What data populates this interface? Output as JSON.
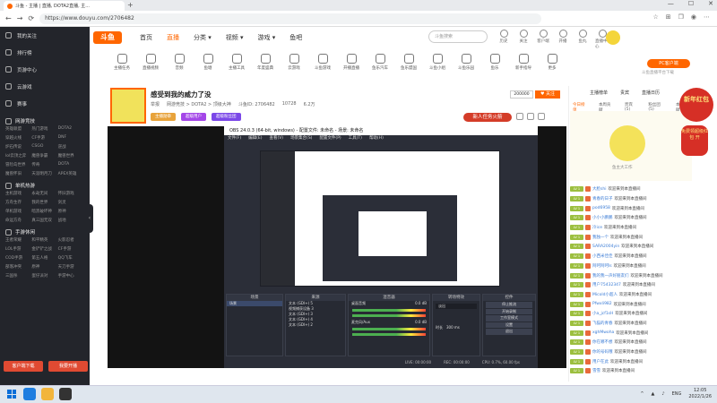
{
  "browser": {
    "tab_title": "斗鱼 - 主播 | 直播, DOTA2直播, 主...",
    "new_tab": "+",
    "url": "https://www.douyu.com/2706482",
    "win_controls": [
      "—",
      "☐",
      "✕"
    ],
    "nav": [
      "←",
      "→",
      "⟳"
    ]
  },
  "header": {
    "logo": "斗鱼",
    "nav": [
      "首页",
      "直播",
      "分类 ▾",
      "视频 ▾",
      "游戏 ▾",
      "鱼吧"
    ],
    "search_placeholder": "斗鱼搜索",
    "tools": [
      "历史",
      "关注",
      "客户端",
      "开播",
      "鱼丸",
      "直播中心"
    ]
  },
  "sidebar": {
    "items": [
      "我的关注",
      "排行榜",
      "页游中心",
      "云游戏",
      "赛事"
    ],
    "sections": [
      {
        "title": "网游竞技",
        "items": [
          "英雄联盟",
          "热门游戏",
          "DOTA2",
          "穿越火线",
          "CF手游",
          "DNF",
          "炉石传说",
          "CSGO",
          "逆战",
          "lol云顶之弈",
          "魔兽争霸",
          "魔兽世界",
          "冒险岛世界",
          "传奇",
          "DOTA",
          "魔兽怀旧",
          "天涯明月刀",
          "APEX英雄"
        ]
      },
      {
        "title": "单机热游",
        "items": [
          "主机游戏",
          "永劫无间",
          "怀旧游戏",
          "方舟生存",
          "我的世界",
          "剑灵",
          "单机游戏",
          "暗黑破坏神",
          "原神",
          "命运方舟",
          "真三国无双",
          "战地"
        ]
      },
      {
        "title": "手游休闲",
        "items": [
          "王者荣耀",
          "和平精英",
          "火影忍者",
          "LOL手游",
          "金铲铲之战",
          "CF手游",
          "COD手游",
          "第五人格",
          "QQ飞车",
          "部落冲突",
          "原神",
          "天刀手游",
          "三国杀",
          "蛋仔派对",
          "手游中心"
        ]
      }
    ],
    "bottom_buttons": [
      "客户端下载",
      "我要开播"
    ],
    "collapse": "‹"
  },
  "categories": [
    "主播任务",
    "直播视频",
    "音频",
    "鱼塘",
    "主播工具",
    "年度盛典",
    "云游戏",
    "斗鱼游戏",
    "开播直播",
    "鱼乐汽车",
    "鱼乐盟国",
    "斗鱼小组",
    "斗鱼乐园",
    "鱼乐",
    "新手指导",
    "更多"
  ],
  "pc_download": {
    "label": "PC客户端",
    "sub": "斗鱼直播平台下载"
  },
  "stream": {
    "title": "感受到我的威力了没",
    "meta": [
      "举报",
      "网游竞技 > DOTA2 > 顶级大神",
      "斗鱼ID: 2706482",
      "10728",
      "6.2万"
    ],
    "tags": [
      "主播勋章",
      "超级用户",
      "超级粉丝团"
    ],
    "fans": "200000",
    "follow": "♥ 关注",
    "task": "新人任务火箭"
  },
  "obs": {
    "title": "OBS 24.0.3 (64-bit, windows) - 配置文件: 未命名 - 场景: 未命名",
    "menu": [
      "文件(F)",
      "编辑(E)",
      "查看(V)",
      "场景集合(S)",
      "配置文件(P)",
      "工具(T)",
      "帮助(H)"
    ],
    "docks": [
      "场景",
      "来源",
      "混音器",
      "转场特效",
      "控件"
    ],
    "scene": "场景",
    "sources": [
      "文本 (GDI+) 5",
      "视频捕获设备 3",
      "文本 (GDI+) 3",
      "文本 (GDI+) 4",
      "文本 (GDI+) 2"
    ],
    "mixer": [
      {
        "name": "桌面音频",
        "db": "0.0 dB"
      },
      {
        "name": "麦克风/Aux",
        "db": "0.0 dB"
      }
    ],
    "transition": "淡出",
    "duration_label": "时长",
    "duration": "300 ms",
    "controls": [
      "停止推流",
      "开始录制",
      "工作室模式",
      "设置",
      "退出"
    ],
    "status": [
      "LIVE: 00:00:00",
      "REC: 00:00:00",
      "CPU: 0.7%, 60.00 fps"
    ]
  },
  "right_panel": {
    "tabs": [
      "主播榜单",
      "贵宾",
      "直播日历"
    ],
    "subtabs": [
      "今日榜单",
      "本周贡献",
      "贵宾(5)",
      "粉丝团(5)",
      "本周贡献"
    ],
    "banner_text": "鱼主大工作",
    "new_year": "新年红包",
    "promo": "免费领超级红包 开",
    "chat": [
      {
        "lv": "LV 1",
        "user": "大脸shi",
        "msg": "欢迎来到本直播间"
      },
      {
        "lv": "LV 1",
        "user": "青春的日子",
        "msg": "欢迎来到本直播间"
      },
      {
        "lv": "LV 1",
        "user": "pod6958",
        "msg": "欢迎来到本直播间"
      },
      {
        "lv": "LV 1",
        "user": "小小小鹏鹏",
        "msg": "欢迎来到本直播间"
      },
      {
        "lv": "LV 1",
        "user": "冷ice",
        "msg": "欢迎来到本直播间"
      },
      {
        "lv": "LV 1",
        "user": "我独一个",
        "msg": "欢迎来到本直播间"
      },
      {
        "lv": "LV 1",
        "user": "SARA2004yin",
        "msg": "欢迎来到本直播间"
      },
      {
        "lv": "LV 1",
        "user": "小西米佳佳",
        "msg": "欢迎来到本直播间"
      },
      {
        "lv": "LV 1",
        "user": "阿呵阿呵ls",
        "msg": "欢迎来到本直播间"
      },
      {
        "lv": "LV 1",
        "user": "我的我一声好朋友们",
        "msg": "欢迎来到本直播间"
      },
      {
        "lv": "LV 1",
        "user": "用户75432347",
        "msg": "欢迎来到本直播间"
      },
      {
        "lv": "LV 1",
        "user": "Micold小超人",
        "msg": "欢迎来到本直播间"
      },
      {
        "lv": "LV 1",
        "user": "Pfwxli982",
        "msg": "欢迎来到本直播间"
      },
      {
        "lv": "LV 1",
        "user": "小a_jcf1sH",
        "msg": "欢迎来到本直播间"
      },
      {
        "lv": "LV 1",
        "user": "飞猫的青春",
        "msg": "欢迎来到本直播间"
      },
      {
        "lv": "LV 1",
        "user": "xghMwoha",
        "msg": "欢迎来到本直播间"
      },
      {
        "lv": "LV 1",
        "user": "你在哪不想",
        "msg": "欢迎来到本直播间"
      },
      {
        "lv": "LV 1",
        "user": "你的号码哦",
        "msg": "欢迎来到本直播间"
      },
      {
        "lv": "LV 1",
        "user": "用户在此",
        "msg": "欢迎来到本直播间"
      },
      {
        "lv": "LV 1",
        "user": "雪雪",
        "msg": "欢迎来到本直播间"
      }
    ]
  },
  "taskbar": {
    "tray": [
      "^",
      "ENG"
    ],
    "time": "12:05",
    "date": "2022/1/26"
  }
}
